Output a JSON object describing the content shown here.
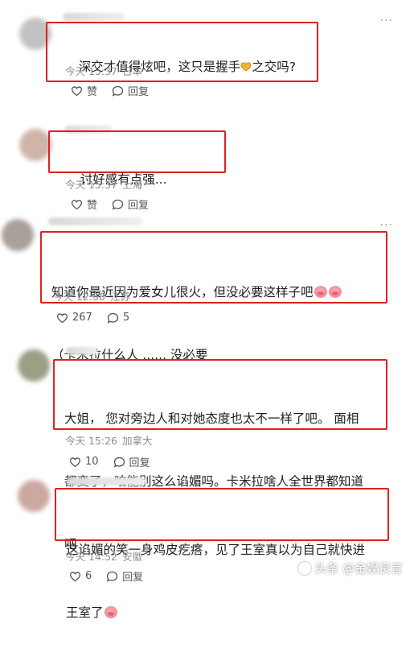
{
  "comments": [
    {
      "text": "深交才值得炫吧，这只是握手",
      "text_tail": "之交吗?",
      "time": "今天 15:37",
      "location": "日本",
      "like_label": "赞",
      "reply_label": "回复",
      "avatar_color": "#b8b8b8"
    },
    {
      "text": "讨好感有点强...",
      "time": "今天 15:37",
      "location": "上海",
      "like_label": "赞",
      "reply_label": "回复",
      "avatar_color": "#c9a79a"
    },
    {
      "text_line1": "知道你最近因为爱女儿很火，但没必要这样子吧",
      "text_line2": "（卡米拉什么人 ...... 没必要",
      "time": "今天 12:58",
      "location": "江苏",
      "like_label": "267",
      "reply_label": "5",
      "avatar_color": "#9b8f8a"
    },
    {
      "text_line1": "大姐， 您对旁边人和对她态度也太不一样了吧。 面相",
      "text_line2": "都变了，咱能别这么谄媚吗。卡米拉啥人全世界都知道",
      "text_line3": "吧",
      "time": "今天 15:26",
      "location": "加拿大",
      "like_label": "10",
      "reply_label": "回复",
      "avatar_color": "#8a8f72"
    },
    {
      "text_line1": "这谄媚的笑一身鸡皮疙瘩，见了王室真以为自己就快进",
      "text_line2": "王室了",
      "time": "今天 14:52",
      "location": "安徽",
      "like_label": "6",
      "reply_label": "回复",
      "avatar_color": "#c49a92"
    }
  ],
  "more_icon": "more-dots-icon",
  "watermark": "头条 @金娱良言",
  "colors": {
    "highlight_box": "#e02020",
    "meta": "#8e8e8e"
  }
}
